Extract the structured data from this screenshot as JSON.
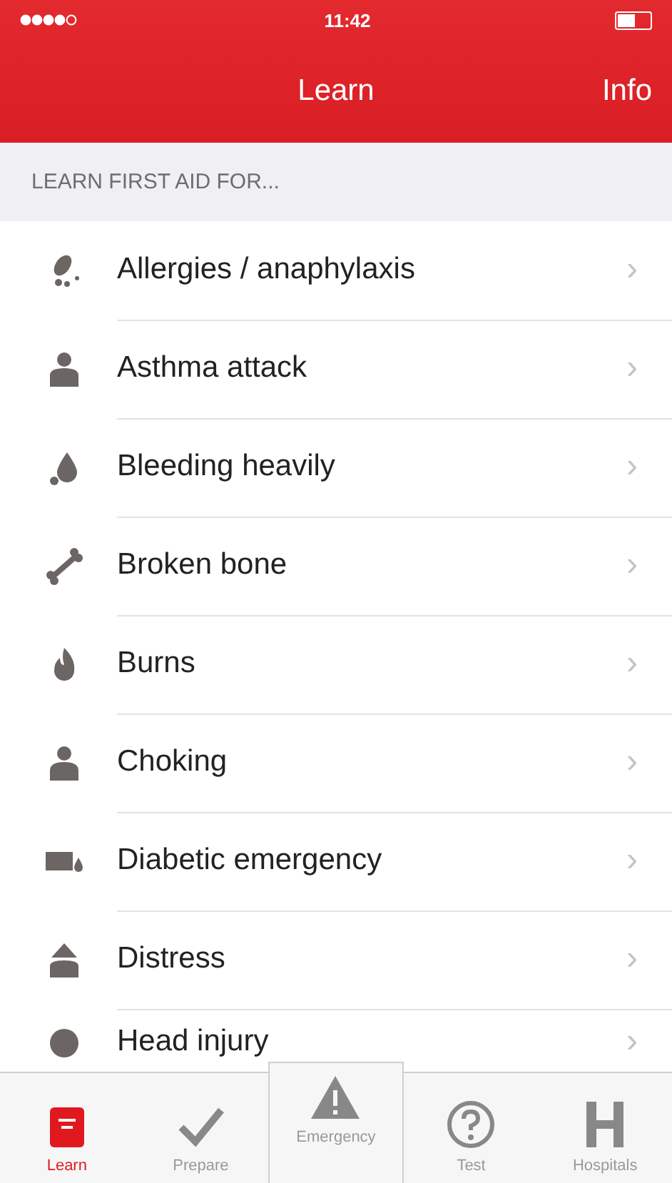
{
  "status_bar": {
    "time": "11:42"
  },
  "nav_bar": {
    "title": "Learn",
    "right_button": "Info"
  },
  "section_header": "LEARN FIRST AID FOR...",
  "items": [
    {
      "label": "Allergies / anaphylaxis",
      "chevron": "›"
    },
    {
      "label": "Asthma attack",
      "chevron": "›"
    },
    {
      "label": "Bleeding heavily",
      "chevron": "›"
    },
    {
      "label": "Broken bone",
      "chevron": "›"
    },
    {
      "label": "Burns",
      "chevron": "›"
    },
    {
      "label": "Choking",
      "chevron": "›"
    },
    {
      "label": "Diabetic emergency",
      "chevron": "›"
    },
    {
      "label": "Distress",
      "chevron": "›"
    },
    {
      "label": "Head injury",
      "chevron": "›"
    }
  ],
  "tab_bar": [
    {
      "label": "Learn",
      "selected": true,
      "raised": false
    },
    {
      "label": "Prepare",
      "selected": false,
      "raised": false
    },
    {
      "label": "Emergency",
      "selected": false,
      "raised": true
    },
    {
      "label": "Test",
      "selected": false,
      "raised": false
    },
    {
      "label": "Hospitals",
      "selected": false,
      "raised": false
    }
  ]
}
